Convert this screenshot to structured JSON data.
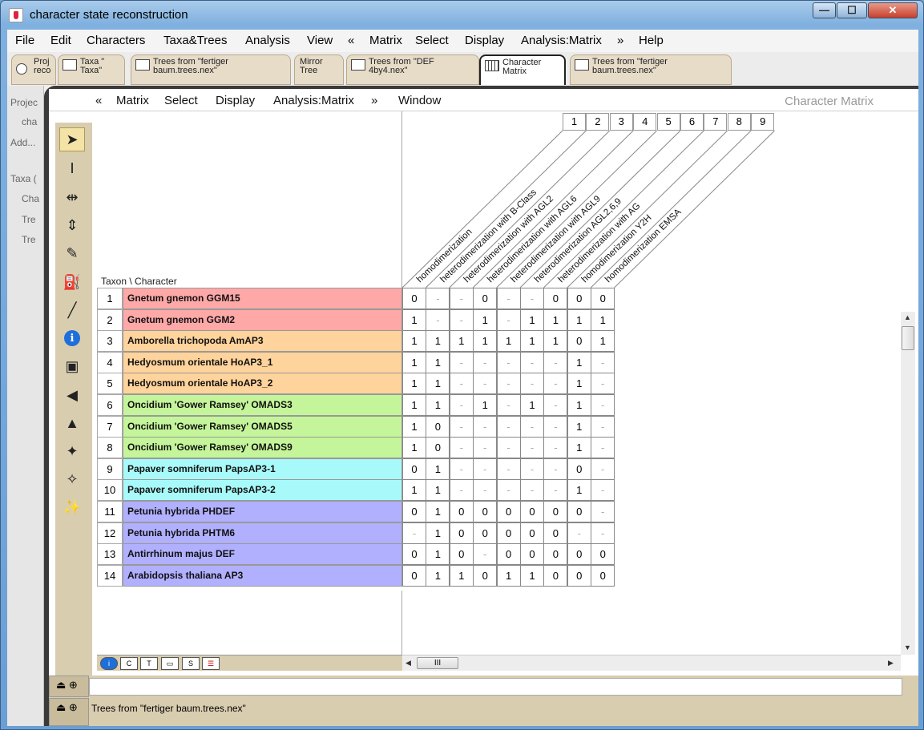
{
  "window": {
    "title": "character state reconstruction",
    "min": "—",
    "max": "☐",
    "close": "✕"
  },
  "menubar": [
    "File",
    "Edit",
    "Characters",
    "Taxa&Trees",
    "Analysis",
    "View",
    "«",
    "Matrix",
    "Select",
    "Display",
    "Analysis:Matrix",
    "»",
    "Help"
  ],
  "tabs": [
    {
      "label": "Proj\nreco",
      "active": false
    },
    {
      "label": "Taxa \"\nTaxa\"",
      "active": false
    },
    {
      "label": "Trees from \"fertiger\nbaum.trees.nex\"",
      "active": false
    },
    {
      "label": "Mirror\nTree",
      "active": false
    },
    {
      "label": "Trees from \"DEF\n4by4.nex\"",
      "active": false
    },
    {
      "label": "Character\nMatrix",
      "active": true
    },
    {
      "label": "Trees from \"fertiger\nbaum.trees.nex\"",
      "active": false
    }
  ],
  "project_panel": [
    "Projec",
    "cha",
    "Add...",
    "Taxa (",
    "Cha",
    "Tre",
    "Tre"
  ],
  "submenu": [
    "«",
    "Matrix",
    "Select",
    "Display",
    "Analysis:Matrix",
    "»",
    "Window"
  ],
  "module_title": "Character Matrix",
  "taxon_header": "Taxon \\ Character",
  "characters": [
    {
      "num": "1",
      "name": "homodimerization"
    },
    {
      "num": "2",
      "name": "heterodimerization with B-Class"
    },
    {
      "num": "3",
      "name": "heterodimerization with AGL2"
    },
    {
      "num": "4",
      "name": "heterodimerization with AGL6"
    },
    {
      "num": "5",
      "name": "heterodimerization with AGL9"
    },
    {
      "num": "6",
      "name": "heterodimerization AGL2,6,9"
    },
    {
      "num": "7",
      "name": "heterodimerization with AG"
    },
    {
      "num": "8",
      "name": "homodimerization Y2H"
    },
    {
      "num": "9",
      "name": "homodimerization EMSA"
    }
  ],
  "taxa": [
    {
      "num": "1",
      "name": "Gnetum gnemon GGM15",
      "color": "#ffa8a8",
      "states": [
        "0",
        "-",
        "-",
        "0",
        "-",
        "-",
        "0",
        "0",
        "0"
      ]
    },
    {
      "num": "2",
      "name": "Gnetum gnemon GGM2",
      "color": "#ffa8a8",
      "states": [
        "1",
        "-",
        "-",
        "1",
        "-",
        "1",
        "1",
        "1",
        "1"
      ]
    },
    {
      "num": "3",
      "name": "Amborella trichopoda AmAP3",
      "color": "#ffd39c",
      "states": [
        "1",
        "1",
        "1",
        "1",
        "1",
        "1",
        "1",
        "0",
        "1"
      ]
    },
    {
      "num": "4",
      "name": "Hedyosmum orientale HoAP3_1",
      "color": "#ffd39c",
      "states": [
        "1",
        "1",
        "-",
        "-",
        "-",
        "-",
        "-",
        "1",
        "-"
      ]
    },
    {
      "num": "5",
      "name": "Hedyosmum orientale HoAP3_2",
      "color": "#ffd39c",
      "states": [
        "1",
        "1",
        "-",
        "-",
        "-",
        "-",
        "-",
        "1",
        "-"
      ]
    },
    {
      "num": "6",
      "name": "Oncidium 'Gower Ramsey' OMADS3",
      "color": "#c5f59a",
      "states": [
        "1",
        "1",
        "-",
        "1",
        "-",
        "1",
        "-",
        "1",
        "-"
      ]
    },
    {
      "num": "7",
      "name": "Oncidium 'Gower Ramsey' OMADS5",
      "color": "#c5f59a",
      "states": [
        "1",
        "0",
        "-",
        "-",
        "-",
        "-",
        "-",
        "1",
        "-"
      ]
    },
    {
      "num": "8",
      "name": "Oncidium 'Gower Ramsey' OMADS9",
      "color": "#c5f59a",
      "states": [
        "1",
        "0",
        "-",
        "-",
        "-",
        "-",
        "-",
        "1",
        "-"
      ]
    },
    {
      "num": "9",
      "name": "Papaver somniferum PapsAP3-1",
      "color": "#a8fafa",
      "states": [
        "0",
        "1",
        "-",
        "-",
        "-",
        "-",
        "-",
        "0",
        "-"
      ]
    },
    {
      "num": "10",
      "name": "Papaver somniferum PapsAP3-2",
      "color": "#a8fafa",
      "states": [
        "1",
        "1",
        "-",
        "-",
        "-",
        "-",
        "-",
        "1",
        "-"
      ]
    },
    {
      "num": "11",
      "name": "Petunia hybrida PHDEF",
      "color": "#b0b0ff",
      "states": [
        "0",
        "1",
        "0",
        "0",
        "0",
        "0",
        "0",
        "0",
        "-"
      ]
    },
    {
      "num": "12",
      "name": "Petunia hybrida PHTM6",
      "color": "#b0b0ff",
      "states": [
        "-",
        "1",
        "0",
        "0",
        "0",
        "0",
        "0",
        "-",
        "-"
      ]
    },
    {
      "num": "13",
      "name": "Antirrhinum majus DEF",
      "color": "#b0b0ff",
      "states": [
        "0",
        "1",
        "0",
        "-",
        "0",
        "0",
        "0",
        "0",
        "0"
      ]
    },
    {
      "num": "14",
      "name": "Arabidopsis thaliana AP3",
      "color": "#b0b0ff",
      "states": [
        "0",
        "1",
        "1",
        "0",
        "1",
        "1",
        "0",
        "0",
        "0"
      ]
    }
  ],
  "hscroll_thumb": "III",
  "log": {
    "line1": "",
    "line2": "Trees from \"fertiger baum.trees.nex\""
  },
  "tool_icons": [
    "arrow-tool-icon",
    "ibeam-tool-icon",
    "expand-columns-icon",
    "expand-rows-icon",
    "pencil-tool-icon",
    "paint-bucket-icon",
    "dropper-icon",
    "info-icon",
    "matrix-kc-icon",
    "triangle-ramp-icon",
    "stack-icon",
    "wand-icon",
    "wand-plus-icon",
    "wand-multi-icon"
  ]
}
